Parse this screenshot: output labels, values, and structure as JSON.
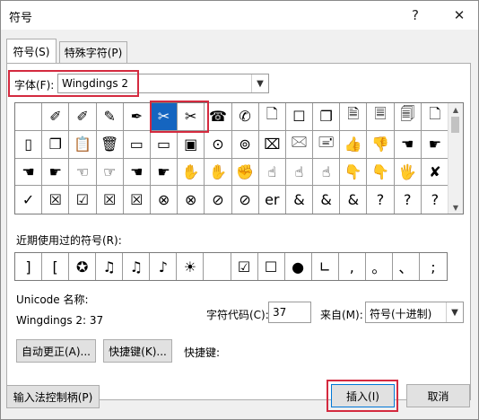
{
  "window": {
    "title": "符号",
    "help_label": "?",
    "close_label": "✕"
  },
  "tabs": [
    {
      "label": "符号(S)",
      "active": true
    },
    {
      "label": "特殊字符(P)",
      "active": false
    }
  ],
  "font": {
    "label": "字体(F):",
    "value": "Wingdings 2"
  },
  "symbol_grid": {
    "rows": [
      [
        "",
        "✐",
        "✐",
        "✎",
        "✒",
        "✂",
        "✂",
        "☎",
        "✆",
        "🗋",
        "☐",
        "❐",
        "🗎",
        "🗏",
        "🗐",
        "🗋"
      ],
      [
        "▯",
        "❐",
        "📋",
        "🗑",
        "▭",
        "▭",
        "▣",
        "⊙",
        "⊚",
        "⌧",
        "🖂",
        "🖃",
        "👍",
        "👎",
        "☚",
        "☛"
      ],
      [
        "☚",
        "☛",
        "☜",
        "☞",
        "☚",
        "☛",
        "✋",
        "✋",
        "✊",
        "☝",
        "☝",
        "☝",
        "👇",
        "👇",
        "🖐",
        "✘"
      ],
      [
        "✓",
        "☒",
        "☑",
        "☒",
        "☒",
        "⊗",
        "⊗",
        "⊘",
        "⊘",
        "er",
        "&",
        "&",
        "&",
        "?",
        "?",
        "?"
      ]
    ],
    "selected": {
      "row": 0,
      "col": 5
    }
  },
  "recent": {
    "label": "近期使用过的符号(R):",
    "symbols": [
      "]",
      "[",
      "✪",
      "♫",
      "♫",
      "♪",
      "☀",
      "",
      "☑",
      "☐",
      "●",
      "∟",
      ",",
      "。",
      "、",
      ";"
    ]
  },
  "info": {
    "unicode_name_label": "Unicode 名称:",
    "unicode_name_value": "Wingdings 2: 37",
    "char_code_label": "字符代码(C):",
    "char_code_value": "37",
    "from_label": "来自(M):",
    "from_value": "符号(十进制)"
  },
  "buttons": {
    "autocorrect": "自动更正(A)...",
    "shortcut_key": "快捷键(K)...",
    "shortcut_label": "快捷键:",
    "ime_pad": "输入法控制柄(P)",
    "insert": "插入(I)",
    "cancel": "取消"
  },
  "colors": {
    "selection": "#1565c0",
    "highlight": "#d42a3f"
  }
}
